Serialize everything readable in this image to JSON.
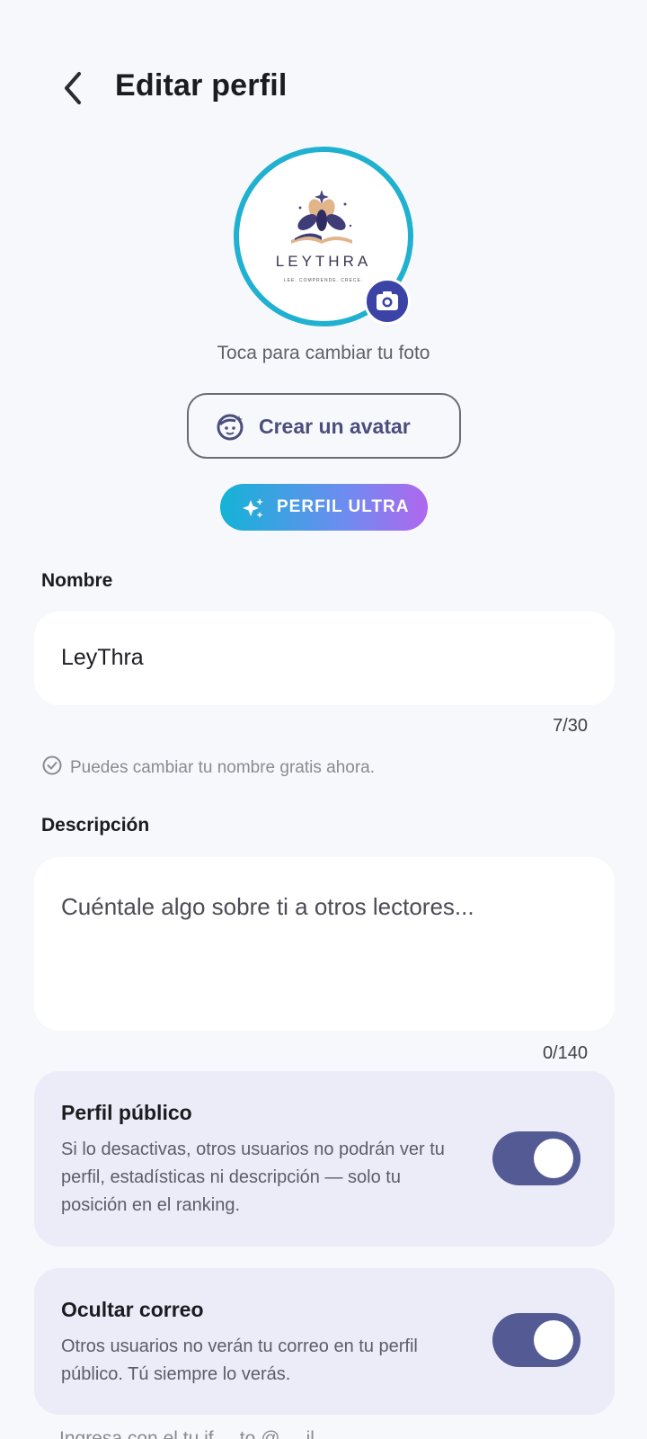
{
  "header": {
    "title": "Editar perfil",
    "back_icon": "chevron-left-icon"
  },
  "avatar": {
    "logo_text": "LEYTHRA",
    "logo_tagline": "LEE. COMPRENDE. CRECE.",
    "ring_color": "#1fb1cf",
    "camera_icon": "camera-icon",
    "hint": "Toca para cambiar tu foto"
  },
  "create_avatar": {
    "label": "Crear un avatar",
    "icon": "face-icon"
  },
  "ultra": {
    "label": "PERFIL ULTRA",
    "icon": "sparkles-icon"
  },
  "name": {
    "label": "Nombre",
    "value": "LeyThra",
    "counter": "7/30",
    "helper": "Puedes cambiar tu nombre gratis ahora.",
    "helper_icon": "check-circle-icon"
  },
  "description": {
    "label": "Descripción",
    "placeholder": "Cuéntale algo sobre ti a otros lectores...",
    "counter": "0/140"
  },
  "settings": {
    "public_profile": {
      "title": "Perfil público",
      "description": "Si lo desactivas, otros usuarios no podrán ver tu perfil, estadísticas ni descripción — solo tu posición en el ranking.",
      "enabled": true
    },
    "hide_email": {
      "title": "Ocultar correo",
      "description": "Otros usuarios no verán tu correo en tu perfil público. Tú siempre lo verás.",
      "enabled": true
    }
  },
  "footer": {
    "partial_text": "Ingresa con el tu if ... to @ ... il"
  },
  "colors": {
    "background": "#f7f8fb",
    "accent": "#3b43a6",
    "toggle_on": "#535a94",
    "card_bg": "#ebecf7"
  }
}
